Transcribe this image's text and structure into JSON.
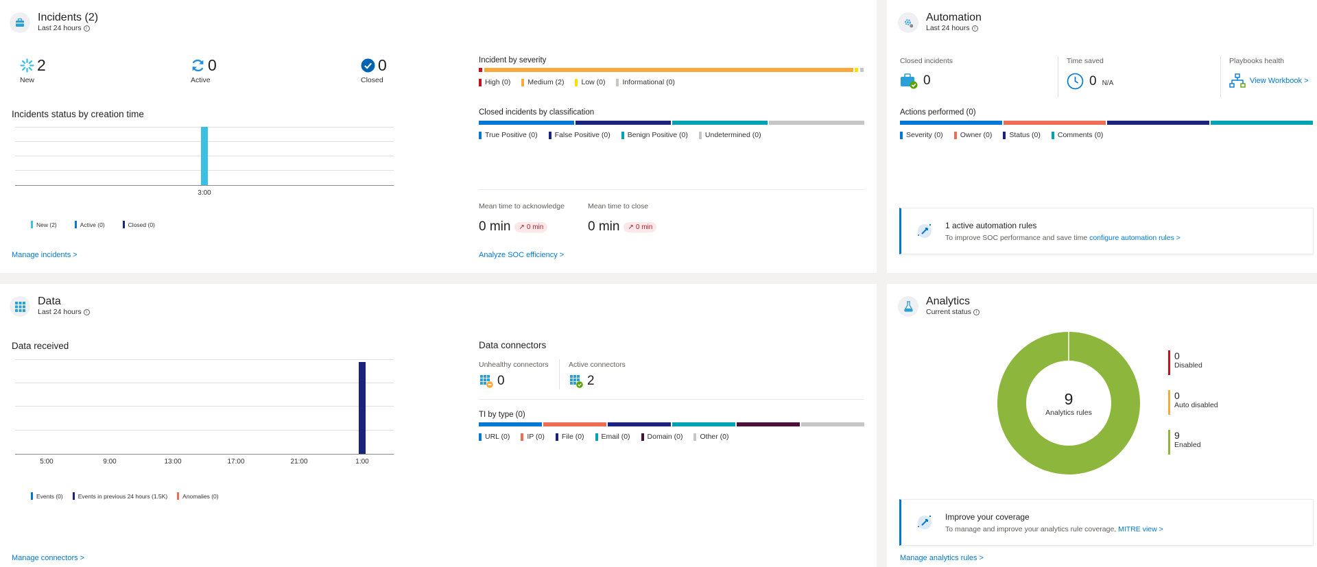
{
  "incidents": {
    "title": "Incidents (2)",
    "subtitle": "Last 24 hours",
    "stats": [
      {
        "value": "2",
        "label": "New"
      },
      {
        "value": "0",
        "label": "Active"
      },
      {
        "value": "0",
        "label": "Closed"
      }
    ],
    "status_chart_title": "Incidents status by creation time",
    "chart_data": {
      "type": "bar",
      "categories": [
        "3:00"
      ],
      "series": [
        {
          "name": "New",
          "values": [
            2
          ]
        },
        {
          "name": "Active",
          "values": [
            0
          ]
        },
        {
          "name": "Closed",
          "values": [
            0
          ]
        }
      ]
    },
    "status_legend": [
      {
        "label": "New (2)",
        "color": "#3bc0e4"
      },
      {
        "label": "Active (0)",
        "color": "#0078d4"
      },
      {
        "label": "Closed (0)",
        "color": "#1a237e"
      }
    ],
    "manage_link": "Manage incidents >",
    "severity_title": "Incident by severity",
    "severity_legend": [
      {
        "label": "High (0)",
        "color": "#c50f1f"
      },
      {
        "label": "Medium (2)",
        "color": "#f7a93b"
      },
      {
        "label": "Low (0)",
        "color": "#fce100"
      },
      {
        "label": "Informational (0)",
        "color": "#c8c6c4"
      }
    ],
    "classification_title": "Closed incidents by classification",
    "classification_legend": [
      {
        "label": "True Positive (0)",
        "color": "#0078d4"
      },
      {
        "label": "False Positive (0)",
        "color": "#1a237e"
      },
      {
        "label": "Benign Positive (0)",
        "color": "#00a3b4"
      },
      {
        "label": "Undetermined (0)",
        "color": "#c8c6c4"
      }
    ],
    "mtta_label": "Mean time to acknowledge",
    "mtta_value": "0 min",
    "mtta_delta": "0 min",
    "mttc_label": "Mean time to close",
    "mttc_value": "0 min",
    "mttc_delta": "0 min",
    "analyze_link": "Analyze SOC efficiency >"
  },
  "automation": {
    "title": "Automation",
    "subtitle": "Last 24 hours",
    "closed_label": "Closed incidents",
    "closed_value": "0",
    "time_label": "Time saved",
    "time_value": "0",
    "time_unit": "N/A",
    "playbooks_label": "Playbooks health",
    "playbooks_link": "View Workbook >",
    "actions_title": "Actions performed (0)",
    "actions_legend": [
      {
        "label": "Severity (0)",
        "color": "#0078d4"
      },
      {
        "label": "Owner (0)",
        "color": "#ed6e54"
      },
      {
        "label": "Status (0)",
        "color": "#1a237e"
      },
      {
        "label": "Comments (0)",
        "color": "#00a3b4"
      }
    ],
    "promo_title": "1 active automation rules",
    "promo_text": "To improve SOC performance and save time",
    "promo_link": "configure automation rules >"
  },
  "data": {
    "title": "Data",
    "subtitle": "Last 24 hours",
    "received_title": "Data received",
    "chart_data": {
      "type": "bar",
      "categories": [
        "5:00",
        "9:00",
        "13:00",
        "17:00",
        "21:00",
        "1:00"
      ],
      "series": [
        {
          "name": "Events",
          "values": [
            0,
            0,
            0,
            0,
            0,
            0
          ]
        },
        {
          "name": "Events in previous 24 hours",
          "values": [
            0,
            0,
            0,
            0,
            0,
            1500
          ]
        },
        {
          "name": "Anomalies",
          "values": [
            0,
            0,
            0,
            0,
            0,
            0
          ]
        }
      ]
    },
    "received_legend": [
      {
        "label": "Events (0)",
        "color": "#0078d4"
      },
      {
        "label": "Events in previous 24 hours (1.5K)",
        "color": "#1a237e"
      },
      {
        "label": "Anomalies (0)",
        "color": "#ed6e54"
      }
    ],
    "manage_link": "Manage connectors >",
    "connectors_title": "Data connectors",
    "unhealthy_label": "Unhealthy connectors",
    "unhealthy_value": "0",
    "active_label": "Active connectors",
    "active_value": "2",
    "ti_title": "TI by type (0)",
    "ti_legend": [
      {
        "label": "URL (0)",
        "color": "#0078d4"
      },
      {
        "label": "IP (0)",
        "color": "#ed6e54"
      },
      {
        "label": "File (0)",
        "color": "#1a237e"
      },
      {
        "label": "Email (0)",
        "color": "#00a3b4"
      },
      {
        "label": "Domain (0)",
        "color": "#4b0f3a"
      },
      {
        "label": "Other (0)",
        "color": "#c8c6c4"
      }
    ]
  },
  "analytics": {
    "title": "Analytics",
    "subtitle": "Current status",
    "donut_value": "9",
    "donut_label": "Analytics rules",
    "chart_data": {
      "type": "pie",
      "categories": [
        "Disabled",
        "Auto disabled",
        "Enabled"
      ],
      "values": [
        0,
        0,
        9
      ],
      "colors": [
        "#c50f1f",
        "#f7a93b",
        "#8cb63c"
      ]
    },
    "legend": [
      {
        "value": "0",
        "label": "Disabled",
        "color": "#c50f1f"
      },
      {
        "value": "0",
        "label": "Auto disabled",
        "color": "#f7a93b"
      },
      {
        "value": "9",
        "label": "Enabled",
        "color": "#8cb63c"
      }
    ],
    "promo_title": "Improve your coverage",
    "promo_text": "To manage and improve your analytics rule coverage,",
    "promo_link": "MITRE view >",
    "manage_link": "Manage analytics rules >"
  }
}
